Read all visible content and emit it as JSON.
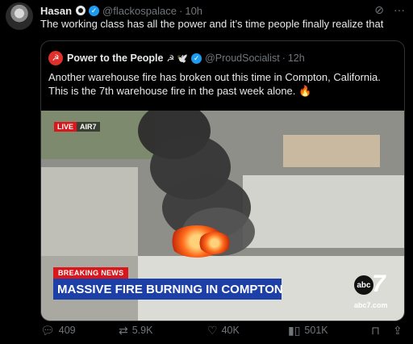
{
  "tweet": {
    "author_name": "Hasan",
    "handle": "@flackospalace",
    "time": "10h",
    "text": "The working class has all the power and it’s time people finally realize that"
  },
  "quote": {
    "author_name": "Power to the People",
    "emoji": "☭ 🕊️",
    "handle": "@ProudSocialist",
    "time": "12h",
    "text": "Another warehouse fire has broken out this time in Compton, California. This is the 7th warehouse fire in the past week alone. 🔥",
    "media": {
      "live_label": "LIVE",
      "air_label": "AIR7",
      "breaking_label": "BREAKING NEWS",
      "headline": "MASSIVE FIRE BURNING IN COMPTON",
      "logo_text": "abc",
      "logo_number": "7",
      "url": "abc7.com"
    }
  },
  "actions": {
    "replies": "409",
    "reposts": "5.9K",
    "likes": "40K",
    "views": "501K"
  },
  "colors": {
    "background": "#000000",
    "text": "#e7e9ea",
    "muted": "#71767b",
    "verified": "#1d9bf0",
    "breaking_red": "#d8161b",
    "headline_blue": "#1c3fa8"
  },
  "icons": [
    "verified-icon",
    "grok-icon",
    "more-icon",
    "reply-icon",
    "repost-icon",
    "like-icon",
    "views-icon",
    "bookmark-icon",
    "share-icon"
  ]
}
